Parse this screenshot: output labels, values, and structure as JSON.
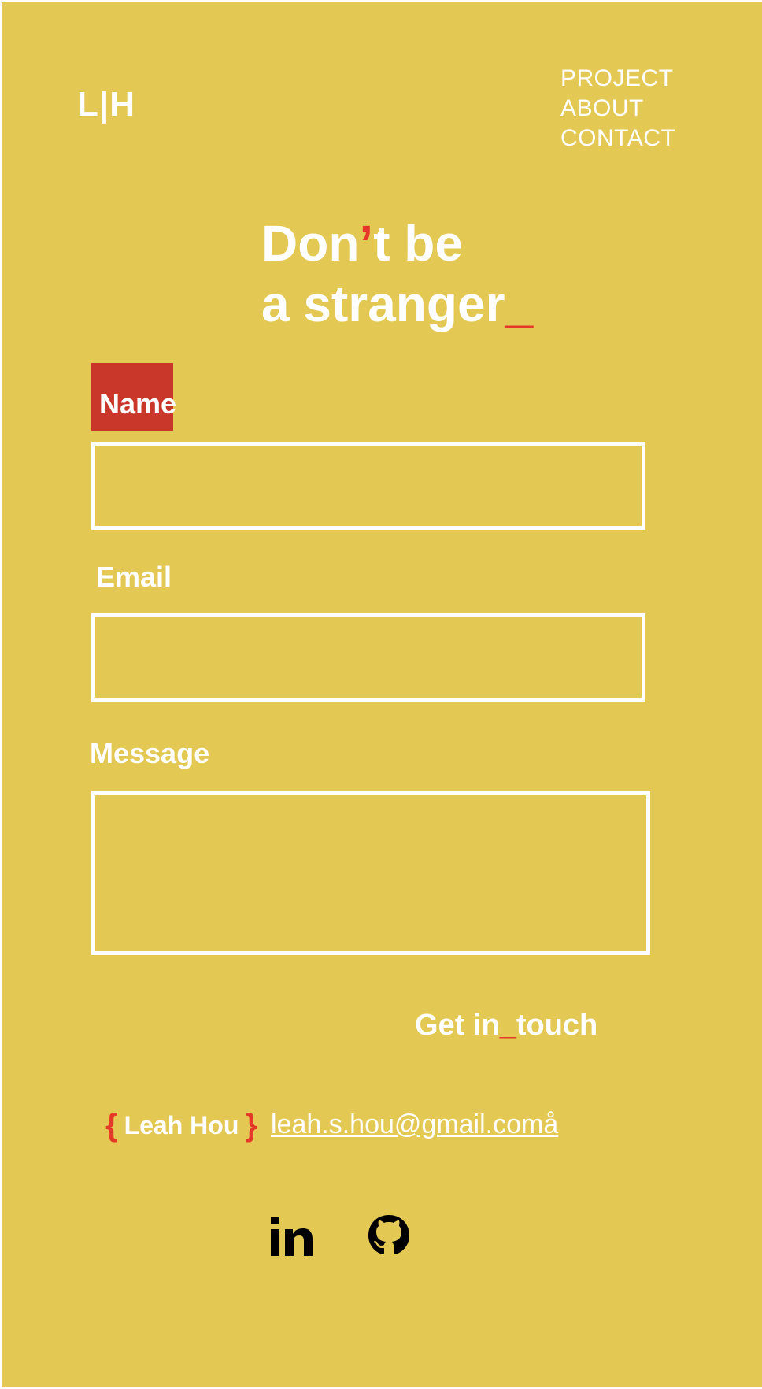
{
  "brand": {
    "logo": "L|H"
  },
  "nav": {
    "items": [
      "PROJECT",
      "ABOUT",
      "CONTACT"
    ]
  },
  "hero": {
    "line1_part1": "Don",
    "line1_apostrophe": "’",
    "line1_part2": "t be",
    "line2": "a stranger",
    "cursor": "_"
  },
  "form": {
    "name_label": "Name",
    "email_label": "Email",
    "message_label": "Message",
    "name_value": "",
    "email_value": "",
    "message_value": "",
    "submit_part1": "Get in",
    "submit_accent": "_",
    "submit_part2": "touch"
  },
  "footer": {
    "brace_open": "{",
    "name": "Leah Hou",
    "brace_close": "}",
    "email": "leah.s.hou@gmail.comå"
  },
  "social": {
    "linkedin_icon": "linkedin-icon",
    "github_icon": "github-icon"
  },
  "colors": {
    "background": "#e3c853",
    "accent": "#e53829",
    "name_highlight": "#c9362a",
    "text": "#ffffff",
    "icon": "#000000"
  }
}
